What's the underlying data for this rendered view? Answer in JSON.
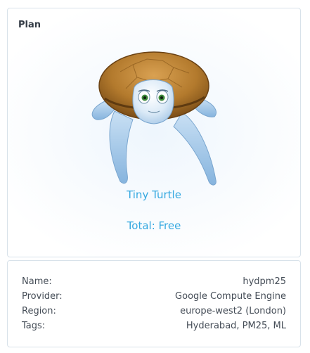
{
  "plan": {
    "heading": "Plan",
    "name": "Tiny Turtle",
    "total": "Total: Free",
    "image_icon": "turtle-icon"
  },
  "details": [
    {
      "label": "Name:",
      "value": "hydpm25"
    },
    {
      "label": "Provider:",
      "value": "Google Compute Engine"
    },
    {
      "label": "Region:",
      "value": "europe-west2 (London)"
    },
    {
      "label": "Tags:",
      "value": "Hyderabad, PM25, ML"
    }
  ],
  "colors": {
    "accent": "#34a8e0",
    "border": "#d8e2ea",
    "text": "#454d57",
    "shell_brown": "#b07a2e",
    "flipper_blue": "#9cc6ea"
  }
}
